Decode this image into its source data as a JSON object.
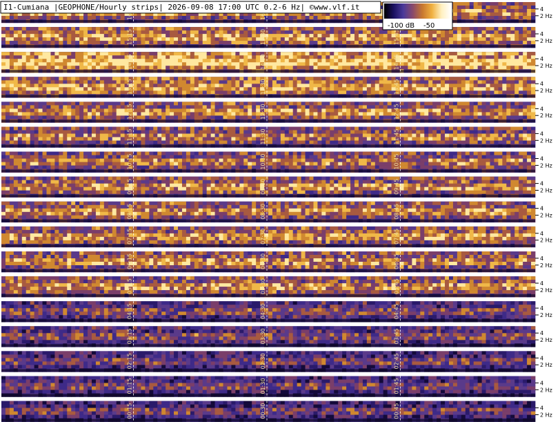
{
  "title": "I1-Cumiana |GEOPHONE/Hourly strips| 2026-09-08 17:00 UTC 0.2-6 Hz| ©www.vlf.it",
  "colorbar": {
    "labels": [
      "-100 dB",
      "-50"
    ],
    "stops": [
      "#000000",
      "#1a1060",
      "#4a3a9a",
      "#8a4a6a",
      "#c87830",
      "#f0b040",
      "#fff0c0",
      "#ffffff"
    ]
  },
  "hz_labels": [
    "4",
    "2 Hz"
  ],
  "chart_data": {
    "type": "heatmap",
    "title": "I1-Cumiana |GEOPHONE/Hourly strips| 2026-09-08 17:00 UTC 0.2-6 Hz| ©www.vlf.it",
    "frequency_range_hz": [
      0.2,
      6
    ],
    "y_ticks_hz": [
      2,
      4
    ],
    "color_range_db": [
      -100,
      -50
    ],
    "strips": [
      {
        "hour": "16",
        "labels": [
          "16:15",
          "16:30",
          "16:45"
        ],
        "intensity": 0.55
      },
      {
        "hour": "15",
        "labels": [
          "15:15",
          "15:30",
          "15:45"
        ],
        "intensity": 0.6
      },
      {
        "hour": "14",
        "labels": [
          "14:15",
          "14:30",
          "14:45"
        ],
        "intensity": 0.75
      },
      {
        "hour": "13",
        "labels": [
          "13:15",
          "13:30",
          "13:45"
        ],
        "intensity": 0.6
      },
      {
        "hour": "12",
        "labels": [
          "12:15",
          "12:30",
          "12:45"
        ],
        "intensity": 0.55
      },
      {
        "hour": "11",
        "labels": [
          "11:15",
          "11:30",
          "11:45"
        ],
        "intensity": 0.5
      },
      {
        "hour": "10",
        "labels": [
          "10:15",
          "10:30",
          "10:45"
        ],
        "intensity": 0.5
      },
      {
        "hour": "09",
        "labels": [
          "09:15",
          "09:30",
          "09:45"
        ],
        "intensity": 0.55
      },
      {
        "hour": "08",
        "labels": [
          "08:15",
          "08:30",
          "08:45"
        ],
        "intensity": 0.55
      },
      {
        "hour": "07",
        "labels": [
          "07:15",
          "07:30",
          "07:45"
        ],
        "intensity": 0.55
      },
      {
        "hour": "06",
        "labels": [
          "06:15",
          "06:30",
          "06:45"
        ],
        "intensity": 0.55
      },
      {
        "hour": "05",
        "labels": [
          "05:15",
          "05:30",
          "05:45"
        ],
        "intensity": 0.55
      },
      {
        "hour": "04",
        "labels": [
          "04:15",
          "04:30",
          "04:45"
        ],
        "intensity": 0.35
      },
      {
        "hour": "03",
        "labels": [
          "03:15",
          "03:30",
          "03:45"
        ],
        "intensity": 0.35
      },
      {
        "hour": "02",
        "labels": [
          "02:15",
          "02:30",
          "02:45"
        ],
        "intensity": 0.3
      },
      {
        "hour": "01",
        "labels": [
          "01:15",
          "01:30",
          "01:45"
        ],
        "intensity": 0.3
      },
      {
        "hour": "00",
        "labels": [
          "00:15",
          "00:30",
          "00:45"
        ],
        "intensity": 0.28
      }
    ]
  }
}
